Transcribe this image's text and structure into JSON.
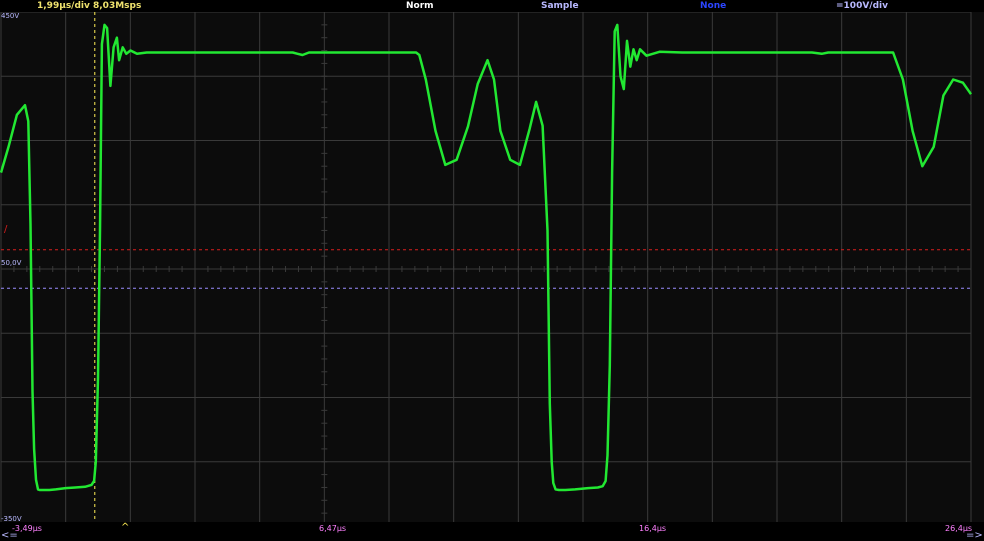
{
  "header": {
    "timebase": "1,99µs/div  8,03Msps",
    "trigger_mode": "Norm",
    "acquisition": "Sample",
    "channel2": "None",
    "vertical": "=100V/div"
  },
  "axis": {
    "top_voltage": "450V",
    "mid_voltage": "50,0V",
    "bottom_voltage": "-350V"
  },
  "time_labels": [
    "-3,49µs",
    "6,47µs",
    "16,4µs",
    "26,4µs"
  ],
  "trigger": {
    "marker": "/",
    "caret": "^"
  },
  "scroll": {
    "left": "<=",
    "right": "=>"
  },
  "colors": {
    "trace": "#22e832",
    "grid": "#3a3a3a",
    "timebase_text": "#f0e36e",
    "white_text": "#ffffff",
    "label_blue": "#b9b9ff",
    "channel2_text": "#2b45ff",
    "vertical_text": "#b9b9ff",
    "trigger_level": "#d81e1e",
    "ground_ref": "#9a8cff",
    "trigger_time": "#ffee55",
    "time_label": "#ff80ff"
  },
  "chart_data": {
    "type": "line",
    "xlabel": "",
    "ylabel": "",
    "xlim": [
      -3.49,
      26.4
    ],
    "ylim": [
      -350,
      450
    ],
    "trigger_level_v": 80,
    "ground_ref_v": 20,
    "trigger_time_us": -0.6,
    "series": [
      {
        "x": [
          -3.49,
          -3.26,
          -3.0,
          -2.75,
          -2.65,
          -2.58,
          -2.52,
          -2.47,
          -2.41,
          -2.35,
          -2.3,
          -2.2,
          -2.0,
          -1.8,
          -1.5,
          -1.2,
          -0.9,
          -0.7,
          -0.62,
          -0.57,
          -0.5,
          -0.44,
          -0.38,
          -0.3,
          -0.22,
          -0.12,
          -0.02,
          0.08,
          0.15,
          0.26,
          0.37,
          0.5,
          0.7,
          1.0,
          2.0,
          4.0,
          5.0,
          5.5,
          5.65,
          5.8,
          6.0,
          6.5,
          7.0,
          8.0,
          9.0,
          9.3,
          9.4,
          9.6,
          9.9,
          10.2,
          10.55,
          10.9,
          11.2,
          11.5,
          11.7,
          11.9,
          12.2,
          12.5,
          12.8,
          13.0,
          13.2,
          13.35,
          13.42,
          13.48,
          13.53,
          13.6,
          13.7,
          13.9,
          14.2,
          14.6,
          14.9,
          15.05,
          15.14,
          15.2,
          15.27,
          15.34,
          15.42,
          15.5,
          15.6,
          15.7,
          15.8,
          15.9,
          16.0,
          16.1,
          16.2,
          16.4,
          16.8,
          17.5,
          20.0,
          21.5,
          21.8,
          22.0,
          22.2,
          22.5,
          24.0,
          24.3,
          24.6,
          24.9,
          25.25,
          25.55,
          25.85,
          26.15,
          26.4
        ],
        "values": [
          200,
          240,
          290,
          305,
          280,
          120,
          -140,
          -230,
          -278,
          -293,
          -294,
          -294,
          -294,
          -293,
          -291,
          -290,
          -289,
          -286,
          -280,
          -250,
          -120,
          110,
          400,
          430,
          425,
          335,
          395,
          410,
          375,
          395,
          385,
          390,
          385,
          387,
          387,
          387,
          387,
          387,
          385,
          383,
          387,
          387,
          387,
          387,
          387,
          387,
          383,
          345,
          265,
          212,
          220,
          272,
          338,
          375,
          345,
          265,
          220,
          212,
          268,
          310,
          273,
          110,
          -160,
          -250,
          -283,
          -293,
          -294,
          -294,
          -293,
          -291,
          -290,
          -288,
          -280,
          -240,
          -100,
          200,
          420,
          430,
          350,
          330,
          405,
          365,
          392,
          375,
          392,
          382,
          388,
          387,
          387,
          387,
          385,
          387,
          387,
          387,
          387,
          345,
          265,
          210,
          240,
          320,
          345,
          340,
          322
        ]
      }
    ]
  }
}
